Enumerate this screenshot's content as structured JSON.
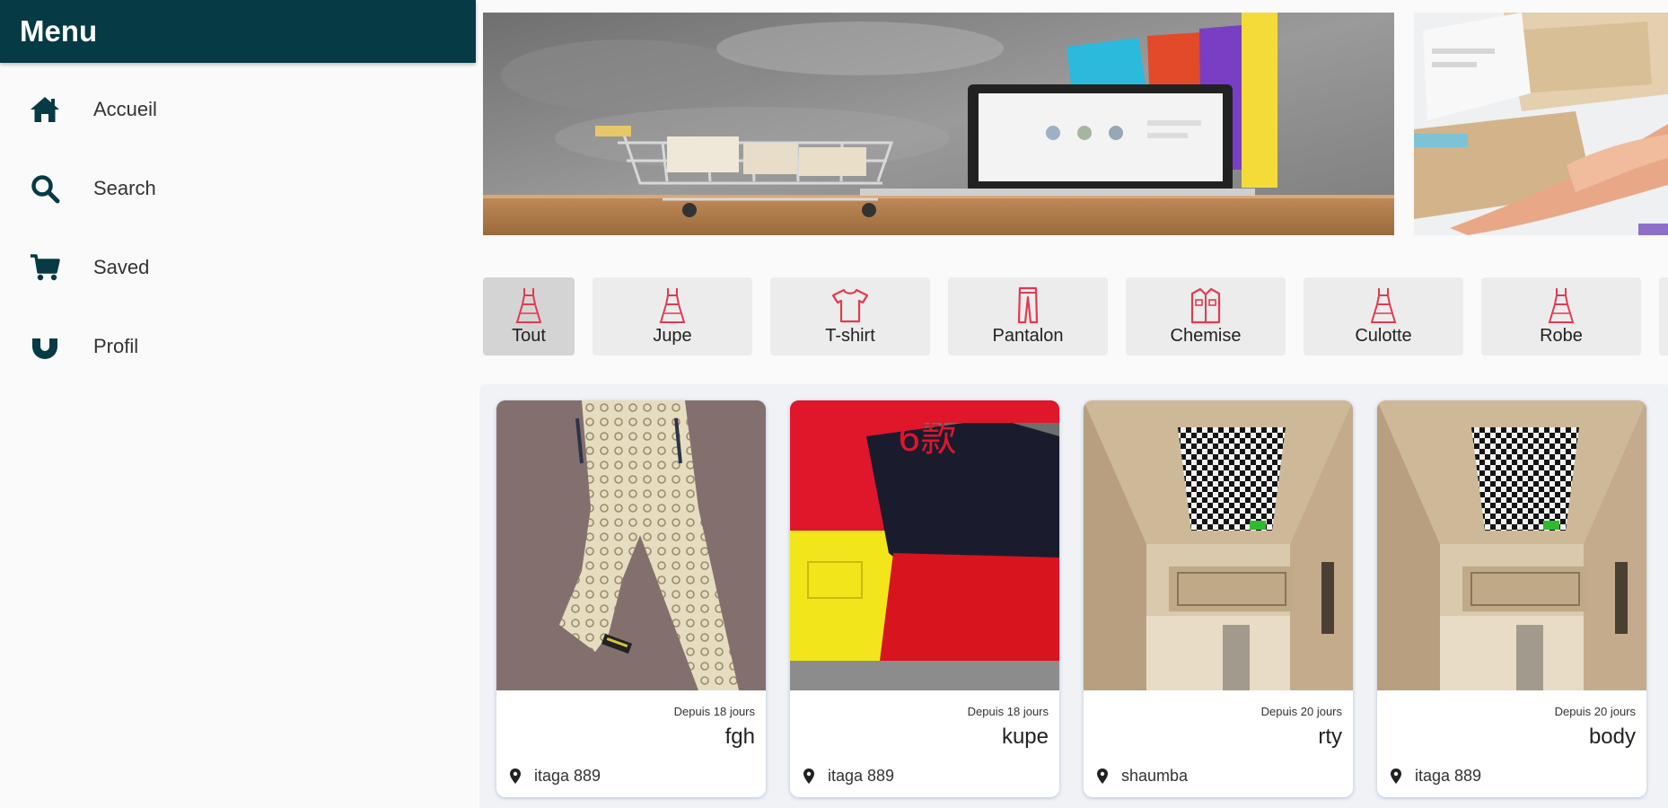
{
  "menu": {
    "title": "Menu",
    "items": [
      {
        "label": "Accueil",
        "icon": "home-icon"
      },
      {
        "label": "Search",
        "icon": "search-icon"
      },
      {
        "label": "Saved",
        "icon": "cart-icon"
      },
      {
        "label": "Profil",
        "icon": "magnet-icon"
      }
    ]
  },
  "categories": [
    {
      "label": "Tout",
      "icon": "dress-icon",
      "active": true
    },
    {
      "label": "Jupe",
      "icon": "dress-icon"
    },
    {
      "label": "T-shirt",
      "icon": "tshirt-icon"
    },
    {
      "label": "Pantalon",
      "icon": "pants-icon"
    },
    {
      "label": "Chemise",
      "icon": "shirt-icon"
    },
    {
      "label": "Culotte",
      "icon": "dress-icon"
    },
    {
      "label": "Robe",
      "icon": "dress-icon"
    }
  ],
  "products": [
    {
      "date": "Depuis 18 jours",
      "title": "fgh",
      "location": "itaga 889"
    },
    {
      "date": "Depuis 18 jours",
      "title": "kupe",
      "location": "itaga 889"
    },
    {
      "date": "Depuis 20 jours",
      "title": "rty",
      "location": "shaumba"
    },
    {
      "date": "Depuis 20 jours",
      "title": "body",
      "location": "itaga 889"
    }
  ],
  "image_text": {
    "product_2": "6款"
  },
  "colors": {
    "header": "#063a45",
    "icon": "#063a45",
    "category_icon": "#e23a52",
    "card_shadow": "#7b96d4"
  }
}
